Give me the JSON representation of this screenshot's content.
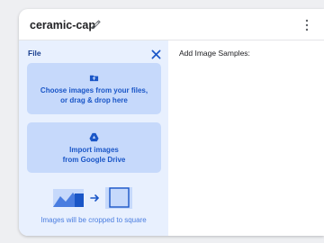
{
  "header": {
    "title": "ceramic-cap",
    "edit_icon": "pencil-icon",
    "menu_icon": "more-vert-icon"
  },
  "upload_panel": {
    "label": "File",
    "close_icon": "close-icon",
    "local_tile": {
      "icon": "folder-upload-icon",
      "line1": "Choose images from your files,",
      "line2": "or drag & drop here"
    },
    "drive_tile": {
      "icon": "google-drive-icon",
      "line1": "Import images",
      "line2": "from Google Drive"
    },
    "crop_note": "Images will be cropped to square"
  },
  "samples_panel": {
    "title": "Add Image Samples:"
  },
  "colors": {
    "accent": "#1a56c7",
    "panel_bg": "#e8f0fe",
    "tile_bg": "#c6d9fb"
  }
}
